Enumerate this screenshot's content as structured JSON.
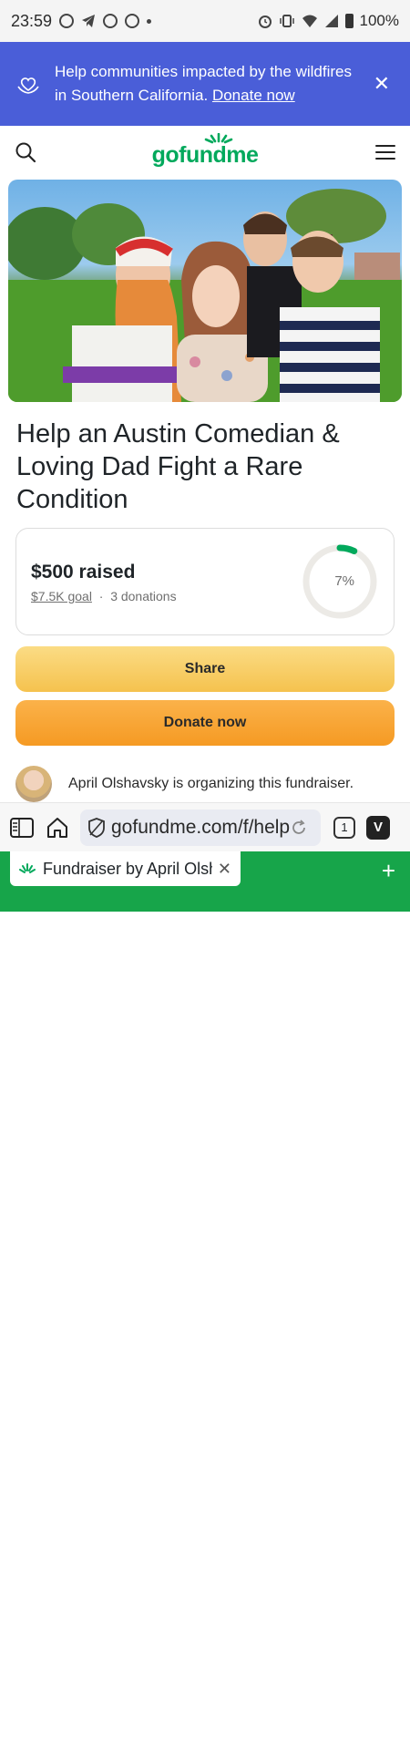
{
  "status_bar": {
    "time": "23:59",
    "battery": "100%"
  },
  "banner": {
    "text": "Help communities impacted by the wildfires in Southern California.",
    "link": "Donate now"
  },
  "header": {
    "logo_text": "gofundme"
  },
  "campaign": {
    "title": "Help an Austin Comedian & Loving Dad Fight a Rare Condition",
    "raised": "$500 raised",
    "goal": "$7.5K goal",
    "separator": "·",
    "donations": "3 donations",
    "percent_label": "7%",
    "progress_fraction": 0.07
  },
  "actions": {
    "share_label": "Share",
    "donate_label": "Donate now"
  },
  "organizer": {
    "text": "April Olshavsky is organizing this fundraiser."
  },
  "browser": {
    "url": "gofundme.com/f/help-an-austin-comedian",
    "tab_count": "1",
    "tab_title": "Fundraiser by April Olshavsky",
    "new_tab": "+"
  },
  "colors": {
    "banner_bg": "#4a5ed8",
    "brand_green": "#02a95c",
    "share_yellow": "#f5c24e",
    "donate_orange": "#f59a23",
    "browser_tab_green": "#17a54a"
  }
}
